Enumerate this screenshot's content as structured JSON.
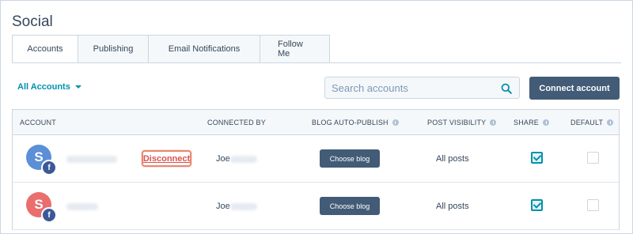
{
  "page": {
    "title": "Social"
  },
  "tabs": [
    {
      "label": "Accounts",
      "active": true
    },
    {
      "label": "Publishing",
      "active": false
    },
    {
      "label": "Email Notifications",
      "active": false
    },
    {
      "label": "Follow Me",
      "active": false
    }
  ],
  "filter": {
    "label": "All Accounts"
  },
  "search": {
    "placeholder": "Search accounts"
  },
  "connect_button": {
    "label": "Connect account"
  },
  "table": {
    "columns": [
      "ACCOUNT",
      "CONNECTED BY",
      "BLOG AUTO-PUBLISH",
      "POST VISIBILITY",
      "SHARE",
      "DEFAULT"
    ],
    "rows": [
      {
        "avatar_letter": "S",
        "avatar_color": "#5b8fd6",
        "network_icon": "f",
        "action_label": "Disconnect",
        "connected_by": "Joe",
        "blog_button": "Choose blog",
        "visibility": "All posts",
        "share": true,
        "default": false
      },
      {
        "avatar_letter": "S",
        "avatar_color": "#ea6e6e",
        "network_icon": "f",
        "action_label": "",
        "connected_by": "Joe",
        "blog_button": "Choose blog",
        "visibility": "All posts",
        "share": true,
        "default": false
      }
    ]
  },
  "colors": {
    "accent": "#0091ae",
    "button": "#425b76",
    "facebook": "#3b5998",
    "highlight": "#e8896f"
  }
}
